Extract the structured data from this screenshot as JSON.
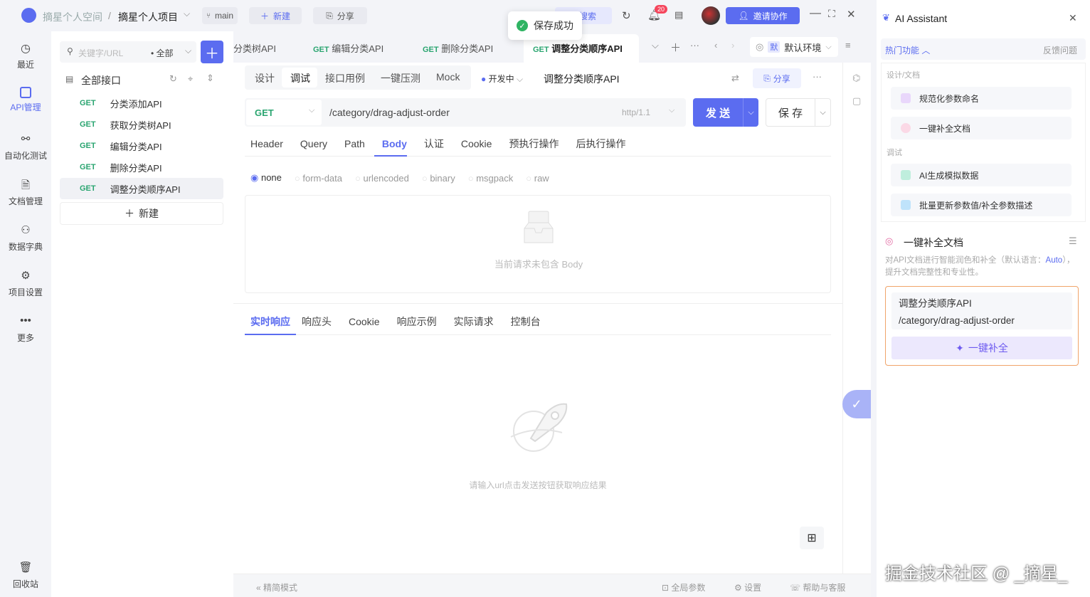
{
  "topbar": {
    "workspace": "摘星个人空间",
    "separator": "/",
    "project": "摘星个人项目",
    "branch": "main",
    "new_label": "新建",
    "share_label": "分享",
    "search_label": "局搜索",
    "notification_count": "20",
    "invite_label": "邀请协作"
  },
  "toast": {
    "text": "保存成功"
  },
  "leftnav": [
    {
      "label": "最近",
      "icon": "history-icon"
    },
    {
      "label": "API管理",
      "icon": "api-icon"
    },
    {
      "label": "自动化测试",
      "icon": "automation-icon"
    },
    {
      "label": "文档管理",
      "icon": "document-icon"
    },
    {
      "label": "数据字典",
      "icon": "dictionary-icon"
    },
    {
      "label": "项目设置",
      "icon": "settings-icon"
    },
    {
      "label": "更多",
      "icon": "more-icon"
    },
    {
      "label": "回收站",
      "icon": "trash-icon"
    }
  ],
  "tree": {
    "search_placeholder": "关键字/URL",
    "filter_label": "全部",
    "all_label": "全部接口",
    "items": [
      {
        "method": "GET",
        "name": "分类添加API"
      },
      {
        "method": "GET",
        "name": "获取分类树API"
      },
      {
        "method": "GET",
        "name": "编辑分类API"
      },
      {
        "method": "GET",
        "name": "删除分类API"
      },
      {
        "method": "GET",
        "name": "调整分类顺序API"
      }
    ],
    "new_label": "新建"
  },
  "tabs": {
    "items": [
      {
        "method": "",
        "name": "分类树API"
      },
      {
        "method": "GET",
        "name": "编辑分类API"
      },
      {
        "method": "GET",
        "name": "删除分类API"
      },
      {
        "method": "GET",
        "name": "调整分类顺序API"
      }
    ],
    "env_short": "默",
    "env_label": "默认环境"
  },
  "subtabs": [
    "设计",
    "调试",
    "接口用例",
    "一键压测",
    "Mock"
  ],
  "status_label": "开发中",
  "api_title": "调整分类顺序API",
  "share_label": "分享",
  "request": {
    "method": "GET",
    "url": "/category/drag-adjust-order",
    "protocol": "http/1.1",
    "send_label": "发 送",
    "save_label": "保 存"
  },
  "param_tabs": [
    "Header",
    "Query",
    "Path",
    "Body",
    "认证",
    "Cookie",
    "预执行操作",
    "后执行操作"
  ],
  "body_types": [
    "none",
    "form-data",
    "urlencoded",
    "binary",
    "msgpack",
    "raw"
  ],
  "body_empty": "当前请求未包含 Body",
  "response_tabs": [
    "实时响应",
    "响应头",
    "Cookie",
    "响应示例",
    "实际请求",
    "控制台"
  ],
  "response_empty": "请输入url点击发送按钮获取响应结果",
  "footer": {
    "mode_label": "精简模式",
    "global_params": "全局参数",
    "settings": "设置",
    "help": "帮助与客服"
  },
  "ai": {
    "title": "AI Assistant",
    "hot_label": "热门功能",
    "feedback_label": "反馈问题",
    "group1": "设计/文档",
    "g1_items": [
      "规范化参数命名",
      "一键补全文档"
    ],
    "group2": "调试",
    "g2_items": [
      "AI生成模拟数据",
      "批量更新参数值/补全参数描述"
    ],
    "feature_title": "一键补全文档",
    "feature_desc_1": "对API文档进行智能润色和补全（默认语言：",
    "feature_lang": "Auto",
    "feature_desc_2": "），提升文档完整性和专业性。",
    "card_title": "调整分类顺序API",
    "card_url": "/category/drag-adjust-order",
    "action_label": "一键补全",
    "watermark": "掘金技术社区 @ _摘星_"
  },
  "colors": {
    "accent": "#5b6cf0",
    "get": "#2aa570",
    "purple": "#6e5bf0",
    "notify": "#f5455c"
  }
}
